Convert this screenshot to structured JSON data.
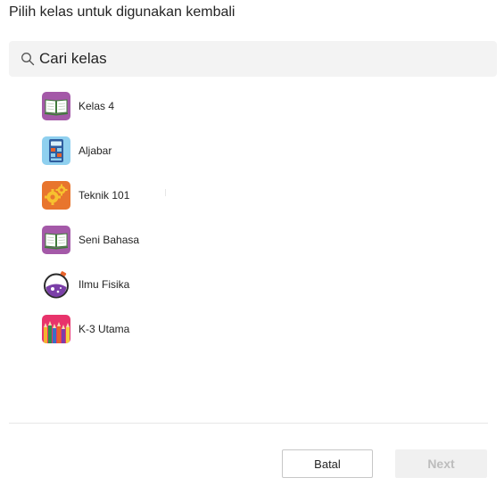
{
  "dialog": {
    "title": "Pilih kelas untuk digunakan kembali"
  },
  "search": {
    "placeholder": "Cari kelas",
    "icon": "search-icon"
  },
  "classes": [
    {
      "label": "Kelas 4",
      "icon": "book-icon",
      "color": "#a459a8"
    },
    {
      "label": "Aljabar",
      "icon": "calculator-icon",
      "color": "#8fd0ef"
    },
    {
      "label": "Teknik 101",
      "icon": "gears-icon",
      "color": "#e8752d"
    },
    {
      "label": "Seni Bahasa",
      "icon": "book-icon",
      "color": "#a459a8"
    },
    {
      "label": "Ilmu Fisika",
      "icon": "flask-icon",
      "color": "#ffffff"
    },
    {
      "label": "K-3 Utama",
      "icon": "pencils-icon",
      "color": "#e8336b"
    }
  ],
  "footer": {
    "cancel_label": "Batal",
    "next_label": "Next"
  }
}
